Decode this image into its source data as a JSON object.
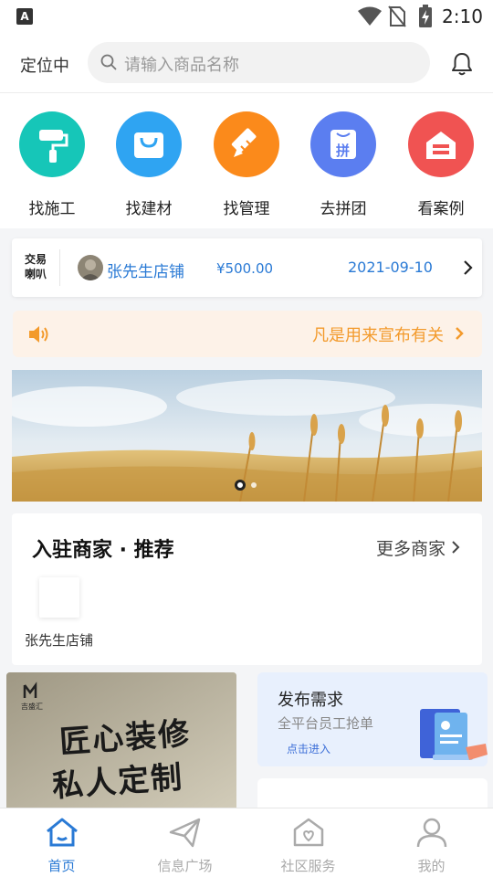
{
  "status_bar": {
    "time": "2:10",
    "notification_glyph": "A"
  },
  "header": {
    "location_label": "定位中",
    "search_placeholder": "请输入商品名称"
  },
  "quick_nav": [
    {
      "label": "找施工",
      "icon": "paint-roller-icon",
      "color": "#16c6b8"
    },
    {
      "label": "找建材",
      "icon": "shopping-bag-icon",
      "color": "#2fa4f2"
    },
    {
      "label": "找管理",
      "icon": "pencil-ruler-icon",
      "color": "#fb8a1b"
    },
    {
      "label": "去拼团",
      "icon": "group-buy-icon",
      "color": "#5b7ef0",
      "glyph": "拼"
    },
    {
      "label": "看案例",
      "icon": "case-house-icon",
      "color": "#f05352"
    }
  ],
  "trade_ticker": {
    "logo_line1": "交易",
    "logo_line2": "喇叭",
    "shop": "张先生店铺",
    "price": "¥500.00",
    "date": "2021-09-10",
    "link_color": "#2a7ad5"
  },
  "notice": {
    "text": "凡是用来宣布有关",
    "color": "#f39a2b"
  },
  "banner": {
    "slide_count": 2,
    "active_index": 0
  },
  "merchants": {
    "title": "入驻商家 · 推荐",
    "more_label": "更多商家",
    "items": [
      {
        "name": "张先生店铺"
      }
    ]
  },
  "promos": {
    "left": {
      "logo_text": "吉盛汇",
      "line1": "匠心装修",
      "line2": "私人定制"
    },
    "right": {
      "title": "发布需求",
      "subtitle": "全平台员工抢单",
      "link": "点击进入"
    }
  },
  "tabbar": {
    "active_color": "#2a7ad5",
    "inactive_color": "#aaaaaa",
    "tabs": [
      {
        "label": "首页",
        "icon": "home-icon",
        "active": true
      },
      {
        "label": "信息广场",
        "icon": "paper-plane-icon",
        "active": false
      },
      {
        "label": "社区服务",
        "icon": "community-house-icon",
        "active": false
      },
      {
        "label": "我的",
        "icon": "user-icon",
        "active": false
      }
    ]
  }
}
